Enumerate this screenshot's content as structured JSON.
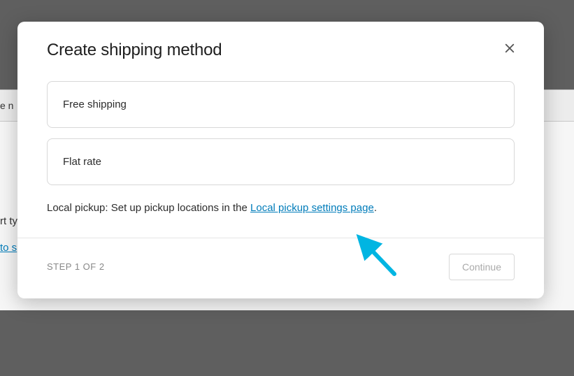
{
  "background": {
    "text1": "e n",
    "text2": "rt ty",
    "link": "to s"
  },
  "modal": {
    "title": "Create shipping method",
    "options": [
      {
        "label": "Free shipping"
      },
      {
        "label": "Flat rate"
      }
    ],
    "hint": {
      "prefix": "Local pickup: Set up pickup locations in the ",
      "link_text": "Local pickup settings page",
      "suffix": "."
    },
    "footer": {
      "step_label": "STEP 1 OF 2",
      "continue_label": "Continue"
    }
  },
  "colors": {
    "link": "#007cba",
    "arrow": "#00b5e2"
  }
}
